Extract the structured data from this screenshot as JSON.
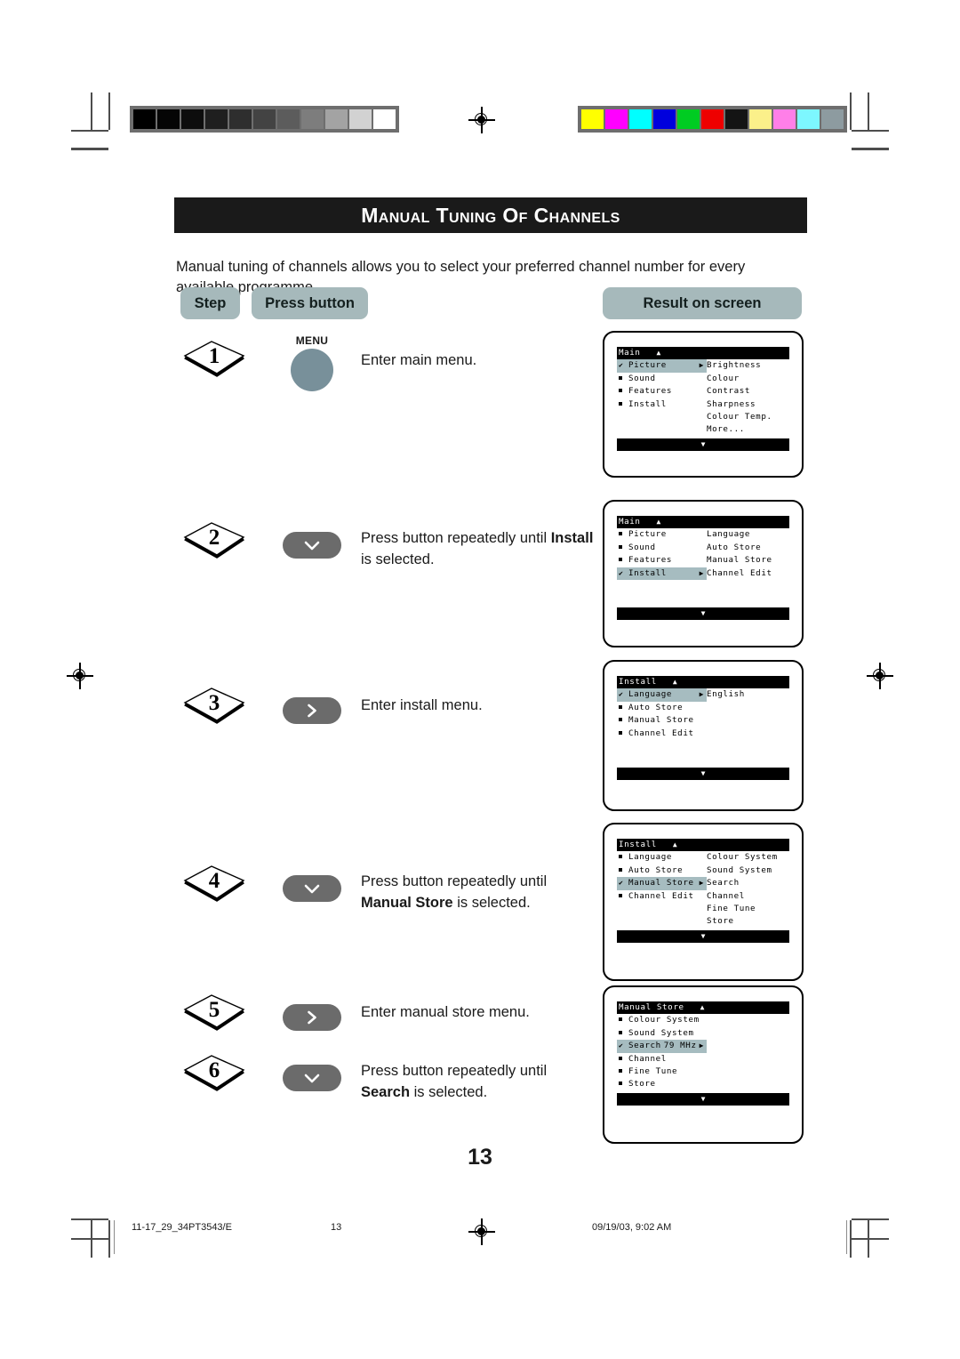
{
  "document": {
    "title": "Manual Tuning of Channels",
    "intro": "Manual tuning of channels allows you to select your preferred channel number for every available programme.",
    "page_number": "13"
  },
  "table_headers": {
    "step": "Step",
    "press_button": "Press button",
    "result_on_screen": "Result on screen"
  },
  "colors": {
    "title_bar": "#1a1a1a",
    "pill": "#a6b9bb",
    "osd_highlight": "#a6bcc0",
    "menu_button": "#78909a",
    "arrow_button": "#6b6b6b"
  },
  "steps": [
    {
      "number": "1",
      "button": {
        "type": "menu-circle",
        "label": "MENU",
        "icon": "menu-button-icon"
      },
      "instruction_plain": "Enter main menu.",
      "instruction_parts": [
        {
          "text": "Enter main menu.",
          "bold": false
        }
      ]
    },
    {
      "number": "2",
      "button": {
        "type": "arrow",
        "label": "",
        "icon": "chevron-down-icon"
      },
      "instruction_plain": "Press button repeatedly until Install is selected.",
      "instruction_parts": [
        {
          "text": "Press button repeatedly until ",
          "bold": false
        },
        {
          "text": "Install",
          "bold": true
        },
        {
          "text": " is selected.",
          "bold": false
        }
      ]
    },
    {
      "number": "3",
      "button": {
        "type": "arrow",
        "label": "",
        "icon": "chevron-right-icon"
      },
      "instruction_plain": "Enter install menu.",
      "instruction_parts": [
        {
          "text": "Enter install menu.",
          "bold": false
        }
      ]
    },
    {
      "number": "4",
      "button": {
        "type": "arrow",
        "label": "",
        "icon": "chevron-down-icon"
      },
      "instruction_plain": "Press button repeatedly until Manual Store is selected.",
      "instruction_parts": [
        {
          "text": "Press button repeatedly until ",
          "bold": false
        },
        {
          "text": "Manual Store",
          "bold": true
        },
        {
          "text": " is selected.",
          "bold": false
        }
      ]
    },
    {
      "number": "5",
      "button": {
        "type": "arrow",
        "label": "",
        "icon": "chevron-right-icon"
      },
      "instruction_plain": "Enter manual store menu.",
      "instruction_parts": [
        {
          "text": "Enter manual store menu.",
          "bold": false
        }
      ]
    },
    {
      "number": "6",
      "button": {
        "type": "arrow",
        "label": "",
        "icon": "chevron-down-icon"
      },
      "instruction_plain": "Press button repeatedly until Search is selected.",
      "instruction_parts": [
        {
          "text": "Press button repeatedly until ",
          "bold": false
        },
        {
          "text": "Search",
          "bold": true
        },
        {
          "text": " is selected.",
          "bold": false
        }
      ]
    }
  ],
  "screens": [
    {
      "id": "screen-main-picture",
      "title": "Main",
      "scroll_up": "▲",
      "scroll_down": "▼",
      "left_items": [
        {
          "label": "Picture",
          "selected": true,
          "arrow": "▶"
        },
        {
          "label": "Sound",
          "selected": false,
          "arrow": ""
        },
        {
          "label": "Features",
          "selected": false,
          "arrow": ""
        },
        {
          "label": "Install",
          "selected": false,
          "arrow": ""
        }
      ],
      "right_items": [
        "Brightness",
        "Colour",
        "Contrast",
        "Sharpness",
        "Colour Temp.",
        "More..."
      ]
    },
    {
      "id": "screen-main-install",
      "title": "Main",
      "scroll_up": "▲",
      "scroll_down": "▼",
      "left_items": [
        {
          "label": "Picture",
          "selected": false,
          "arrow": ""
        },
        {
          "label": "Sound",
          "selected": false,
          "arrow": ""
        },
        {
          "label": "Features",
          "selected": false,
          "arrow": ""
        },
        {
          "label": "Install",
          "selected": true,
          "arrow": "▶"
        }
      ],
      "right_items": [
        "Language",
        "Auto Store",
        "Manual Store",
        "Channel Edit"
      ]
    },
    {
      "id": "screen-install-language",
      "title": "Install",
      "scroll_up": "▲",
      "scroll_down": "▼",
      "left_items": [
        {
          "label": "Language",
          "selected": true,
          "arrow": "▶"
        },
        {
          "label": "Auto Store",
          "selected": false,
          "arrow": ""
        },
        {
          "label": "Manual Store",
          "selected": false,
          "arrow": ""
        },
        {
          "label": "Channel Edit",
          "selected": false,
          "arrow": ""
        }
      ],
      "right_items": [
        "English"
      ]
    },
    {
      "id": "screen-install-manual-store",
      "title": "Install",
      "scroll_up": "▲",
      "scroll_down": "▼",
      "left_items": [
        {
          "label": "Language",
          "selected": false,
          "arrow": ""
        },
        {
          "label": "Auto Store",
          "selected": false,
          "arrow": ""
        },
        {
          "label": "Manual Store",
          "selected": true,
          "arrow": "▶"
        },
        {
          "label": "Channel Edit",
          "selected": false,
          "arrow": ""
        }
      ],
      "right_items": [
        "Colour System",
        "Sound System",
        "Search",
        "Channel",
        "Fine Tune",
        "Store"
      ]
    },
    {
      "id": "screen-manual-store-search",
      "title": "Manual Store",
      "scroll_up": "▲",
      "scroll_down": "▼",
      "left_items": [
        {
          "label": "Colour System",
          "selected": false,
          "arrow": "",
          "value": ""
        },
        {
          "label": "Sound System",
          "selected": false,
          "arrow": "",
          "value": ""
        },
        {
          "label": "Search",
          "selected": true,
          "arrow": "▶",
          "value": "79 MHz"
        },
        {
          "label": "Channel",
          "selected": false,
          "arrow": "",
          "value": ""
        },
        {
          "label": "Fine Tune",
          "selected": false,
          "arrow": "",
          "value": ""
        },
        {
          "label": "Store",
          "selected": false,
          "arrow": "",
          "value": ""
        }
      ],
      "right_items": []
    }
  ],
  "footer": {
    "file_reference": "11-17_29_34PT3543/E",
    "page": "13",
    "timestamp": "09/19/03, 9:02 AM"
  },
  "calibration": {
    "grayscale_label": "grayscale-calibration-bar",
    "grayscale_swatches": [
      "#000000",
      "#050505",
      "#0d0d0d",
      "#1f1f1f",
      "#2e2e2e",
      "#434343",
      "#5c5c5c",
      "#7d7d7d",
      "#a3a3a3",
      "#d2d2d2",
      "#ffffff"
    ],
    "color_label": "color-calibration-bar",
    "color_swatches": [
      "#ffff00",
      "#ff00ff",
      "#00ffff",
      "#0000dd",
      "#00cc22",
      "#ee0000",
      "#141414",
      "#fbf08a",
      "#ff7fe8",
      "#7df7ff",
      "#8d9ba0"
    ]
  }
}
